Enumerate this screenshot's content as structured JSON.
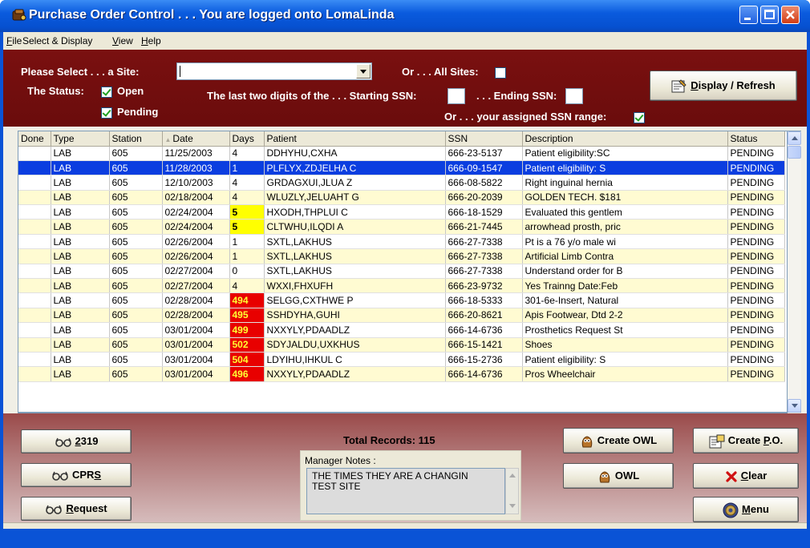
{
  "window": {
    "title": "Purchase Order Control . . .  You are logged onto LomaLinda"
  },
  "menu": {
    "file": {
      "u": "F",
      "rest": "ile"
    },
    "select": {
      "pre": "Select & Display",
      "u": "",
      "rest": ""
    },
    "view": {
      "u": "V",
      "rest": "iew"
    },
    "help": {
      "u": "H",
      "rest": "elp"
    }
  },
  "filters": {
    "site_label": "Please Select . . . a Site:",
    "site_value": "",
    "all_sites_label": "Or . . . All Sites:",
    "all_sites_checked": false,
    "status_label": "The Status:",
    "open_label": "Open",
    "open_checked": true,
    "pending_label": "Pending",
    "pending_checked": true,
    "ssn_start_label": "The last two digits of the . . . Starting SSN:",
    "ssn_end_label": ". . . Ending SSN:",
    "assigned_label": "Or . . . your assigned SSN range:",
    "assigned_checked": true
  },
  "buttons": {
    "display_refresh": {
      "u": "D",
      "rest": "isplay / Refresh"
    },
    "b2319": {
      "u": "2",
      "rest": "319"
    },
    "cprs": {
      "pre": "CPR",
      "u": "S",
      "rest": ""
    },
    "request": {
      "u": "R",
      "rest": "equest"
    },
    "create_owl": "Create OWL",
    "owl": "OWL",
    "create_po": {
      "pre": "Create ",
      "u": "P",
      "rest": ".O."
    },
    "clear": {
      "u": "C",
      "rest": "lear"
    },
    "menu": {
      "u": "M",
      "rest": "enu"
    }
  },
  "grid": {
    "columns": [
      "Done",
      "Type",
      "Station",
      "Date",
      "Days",
      "Patient",
      "SSN",
      "Description",
      "Status"
    ],
    "rows": [
      {
        "done": "",
        "type": "LAB",
        "station": "605",
        "date": "11/25/2003",
        "days": "4",
        "patient": "DDHYHU,CXHA",
        "ssn": "666-23-5137",
        "desc": "Patient eligibility:SC",
        "status": "PENDING",
        "flag": ""
      },
      {
        "done": "",
        "type": "LAB",
        "station": "605",
        "date": "11/28/2003",
        "days": "1",
        "patient": "PLFLYX,ZDJELHA C",
        "ssn": "666-09-1547",
        "desc": "Patient eligibility: S",
        "status": "PENDING",
        "flag": "",
        "selected": true
      },
      {
        "done": "",
        "type": "LAB",
        "station": "605",
        "date": "12/10/2003",
        "days": "4",
        "patient": "GRDAGXUI,JLUA Z",
        "ssn": "666-08-5822",
        "desc": "Right inguinal hernia",
        "status": "PENDING",
        "flag": ""
      },
      {
        "done": "",
        "type": "LAB",
        "station": "605",
        "date": "02/18/2004",
        "days": "4",
        "patient": "WLUZLY,JELUAHT G",
        "ssn": "666-20-2039",
        "desc": "GOLDEN TECH.     $181",
        "status": "PENDING",
        "flag": ""
      },
      {
        "done": "",
        "type": "LAB",
        "station": "605",
        "date": "02/24/2004",
        "days": "5",
        "patient": "HXODH,THPLUI C",
        "ssn": "666-18-1529",
        "desc": "Evaluated this gentlem",
        "status": "PENDING",
        "flag": "warn"
      },
      {
        "done": "",
        "type": "LAB",
        "station": "605",
        "date": "02/24/2004",
        "days": "5",
        "patient": "CLTWHU,ILQDI A",
        "ssn": "666-21-7445",
        "desc": "arrowhead prosth, pric",
        "status": "PENDING",
        "flag": "warn"
      },
      {
        "done": "",
        "type": "LAB",
        "station": "605",
        "date": "02/26/2004",
        "days": "1",
        "patient": "SXTL,LAKHUS",
        "ssn": "666-27-7338",
        "desc": "Pt is a 76 y/o male wi",
        "status": "PENDING",
        "flag": ""
      },
      {
        "done": "",
        "type": "LAB",
        "station": "605",
        "date": "02/26/2004",
        "days": "1",
        "patient": "SXTL,LAKHUS",
        "ssn": "666-27-7338",
        "desc": "Artificial Limb Contra",
        "status": "PENDING",
        "flag": ""
      },
      {
        "done": "",
        "type": "LAB",
        "station": "605",
        "date": "02/27/2004",
        "days": "0",
        "patient": "SXTL,LAKHUS",
        "ssn": "666-27-7338",
        "desc": "Understand order for B",
        "status": "PENDING",
        "flag": ""
      },
      {
        "done": "",
        "type": "LAB",
        "station": "605",
        "date": "02/27/2004",
        "days": "4",
        "patient": "WXXI,FHXUFH",
        "ssn": "666-23-9732",
        "desc": "Yes Trainng  Date:Feb",
        "status": "PENDING",
        "flag": ""
      },
      {
        "done": "",
        "type": "LAB",
        "station": "605",
        "date": "02/28/2004",
        "days": "494",
        "patient": "SELGG,CXTHWE P",
        "ssn": "666-18-5333",
        "desc": "301-6e-Insert, Natural",
        "status": "PENDING",
        "flag": "alert"
      },
      {
        "done": "",
        "type": "LAB",
        "station": "605",
        "date": "02/28/2004",
        "days": "495",
        "patient": "SSHDYHA,GUHI",
        "ssn": "666-20-8621",
        "desc": "Apis Footwear, Dtd 2-2",
        "status": "PENDING",
        "flag": "alert"
      },
      {
        "done": "",
        "type": "LAB",
        "station": "605",
        "date": "03/01/2004",
        "days": "499",
        "patient": "NXXYLY,PDAADLZ",
        "ssn": "666-14-6736",
        "desc": "Prosthetics Request St",
        "status": "PENDING",
        "flag": "alert"
      },
      {
        "done": "",
        "type": "LAB",
        "station": "605",
        "date": "03/01/2004",
        "days": "502",
        "patient": "SDYJALDU,UXKHUS",
        "ssn": "666-15-1421",
        "desc": "Shoes",
        "status": "PENDING",
        "flag": "alert"
      },
      {
        "done": "",
        "type": "LAB",
        "station": "605",
        "date": "03/01/2004",
        "days": "504",
        "patient": "LDYIHU,IHKUL C",
        "ssn": "666-15-2736",
        "desc": "Patient eligibility: S",
        "status": "PENDING",
        "flag": "alert"
      },
      {
        "done": "",
        "type": "LAB",
        "station": "605",
        "date": "03/01/2004",
        "days": "496",
        "patient": "NXXYLY,PDAADLZ",
        "ssn": "666-14-6736",
        "desc": "Pros Wheelchair",
        "status": "PENDING",
        "flag": "alert"
      }
    ]
  },
  "footer": {
    "total_records": "Total Records: 115",
    "notes_label": "Manager Notes :",
    "notes_text": "THE TIMES THEY ARE A  CHANGIN\nTEST SITE"
  },
  "colors": {
    "panel_red": "#7a1010",
    "row_alt": "#fffbd2",
    "selected": "#0b3ee0",
    "days_warn": "#ffff00",
    "days_alert": "#e80000"
  }
}
